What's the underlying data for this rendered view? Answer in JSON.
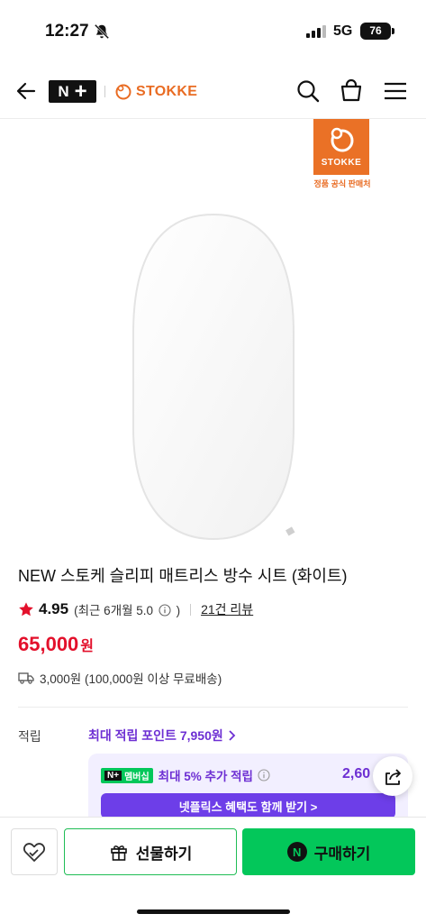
{
  "status_bar": {
    "time": "12:27",
    "network": "5G",
    "battery": "76"
  },
  "header": {
    "nplus_label": "N",
    "brand_name": "STOKKE",
    "icons": [
      "back-arrow-icon",
      "search-icon",
      "shopping-bag-icon",
      "menu-icon"
    ]
  },
  "product": {
    "badge_brand": "STOKKE",
    "badge_caption": "정품 공식 판매처",
    "title": "NEW 스토케 슬리피 매트리스 방수 시트 (화이트)",
    "rating": "4.95",
    "rating_recent_prefix": "(최근 6개월 5.0",
    "rating_recent_suffix": ")",
    "review_count": "21건 리뷰",
    "price": "65,000",
    "price_unit": "원",
    "shipping": "3,000원 (100,000원 이상 무료배송)"
  },
  "points": {
    "label": "적립",
    "max_points": "최대 적립 포인트 7,950원",
    "membership_badge": "멤버십",
    "membership_text": "최대 5% 추가 적립",
    "membership_amount": "2,60",
    "netflix_button": "넷플릭스 혜택도 함께 받기 >"
  },
  "bottom_bar": {
    "gift_label": "선물하기",
    "buy_label": "구매하기",
    "npay_letter": "N"
  },
  "colors": {
    "accent_green": "#03c75a",
    "price_red": "#e3102b",
    "points_purple": "#6d2fd3",
    "stokke_orange": "#ea7126"
  }
}
